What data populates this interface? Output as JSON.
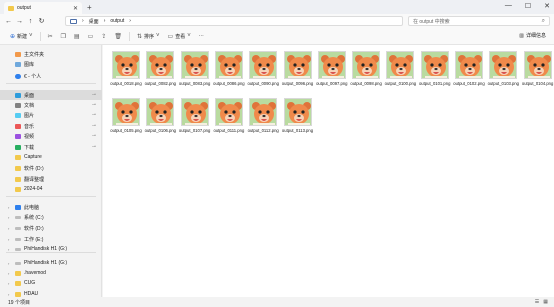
{
  "window": {
    "tab_title": "output",
    "new_tab": "+",
    "minimize": "—",
    "maximize": "☐",
    "close": "✕"
  },
  "nav": {
    "back_icon": "arrow-left-icon",
    "forward_icon": "arrow-right-icon",
    "up_icon": "arrow-up-icon",
    "refresh_icon": "refresh-icon",
    "breadcrumb": [
      "桌面",
      "output"
    ],
    "search_placeholder": "在 output 中搜索"
  },
  "toolbar": {
    "new_label": "新建",
    "sort_label": "排序",
    "view_label": "查看",
    "more_label": "···",
    "details_label": "详细信息"
  },
  "sidebar": {
    "items": [
      {
        "label": "主文件夹",
        "icon": "home-icon",
        "type": "home"
      },
      {
        "label": "图库",
        "icon": "gallery-icon",
        "type": "gallery"
      },
      {
        "label": "€ - 个人",
        "icon": "cloud-icon",
        "type": "cloud"
      },
      {
        "label": "桌面",
        "icon": "desktop-icon",
        "type": "desktop",
        "selected": true,
        "pinned": true
      },
      {
        "label": "文档",
        "icon": "document-icon",
        "type": "doc",
        "pinned": true
      },
      {
        "label": "图片",
        "icon": "picture-icon",
        "type": "pic",
        "pinned": true
      },
      {
        "label": "音乐",
        "icon": "music-icon",
        "type": "music",
        "pinned": true
      },
      {
        "label": "视频",
        "icon": "video-icon",
        "type": "video",
        "pinned": true
      },
      {
        "label": "下载",
        "icon": "download-icon",
        "type": "dl",
        "pinned": true
      },
      {
        "label": "Capture",
        "icon": "folder-icon",
        "type": "folder"
      },
      {
        "label": "软件 (D:)",
        "icon": "folder-icon",
        "type": "folder"
      },
      {
        "label": "翻译整理",
        "icon": "folder-icon",
        "type": "folder"
      },
      {
        "label": "2024-04",
        "icon": "folder-icon",
        "type": "folder"
      },
      {
        "label": "此电脑",
        "icon": "computer-icon",
        "type": "pc",
        "expandable": true
      },
      {
        "label": "系统 (C:)",
        "icon": "drive-icon",
        "type": "drive",
        "expandable": true
      },
      {
        "label": "软件 (D:)",
        "icon": "drive-icon",
        "type": "drive",
        "expandable": true
      },
      {
        "label": "工作 (E:)",
        "icon": "drive-icon",
        "type": "drive",
        "expandable": true
      },
      {
        "label": "PhiHandisk H1 (G:)",
        "icon": "drive-icon",
        "type": "drive",
        "expandable": true
      },
      {
        "label": "PhiHandisk H1 (G:)",
        "icon": "drive-icon",
        "type": "drive",
        "expandable": true
      },
      {
        "label": ".havemod",
        "icon": "folder-icon",
        "type": "folder",
        "expandable": true
      },
      {
        "label": "CUG",
        "icon": "folder-icon",
        "type": "folder",
        "expandable": true
      },
      {
        "label": "HDAU",
        "icon": "folder-icon",
        "type": "folder",
        "expandable": true
      }
    ]
  },
  "files": [
    {
      "name": "output_0018.png"
    },
    {
      "name": "output_0082.png"
    },
    {
      "name": "output_0083.png"
    },
    {
      "name": "output_0086.png"
    },
    {
      "name": "output_0090.png"
    },
    {
      "name": "output_0096.png"
    },
    {
      "name": "output_0097.png"
    },
    {
      "name": "output_0098.png"
    },
    {
      "name": "output_0100.png"
    },
    {
      "name": "output_0101.png"
    },
    {
      "name": "output_0102.png"
    },
    {
      "name": "output_0103.png"
    },
    {
      "name": "output_0104.png"
    },
    {
      "name": "output_0105.png"
    },
    {
      "name": "output_0106.png"
    },
    {
      "name": "output_0107.png"
    },
    {
      "name": "output_0111.png"
    },
    {
      "name": "output_0112.png"
    },
    {
      "name": "output_0113.png"
    }
  ],
  "status": {
    "count": "19 个项目"
  },
  "colors": {
    "thumb_bg": "#b9dba0",
    "bear_face": "#f08a4b",
    "accent": "#2b6cd4"
  }
}
